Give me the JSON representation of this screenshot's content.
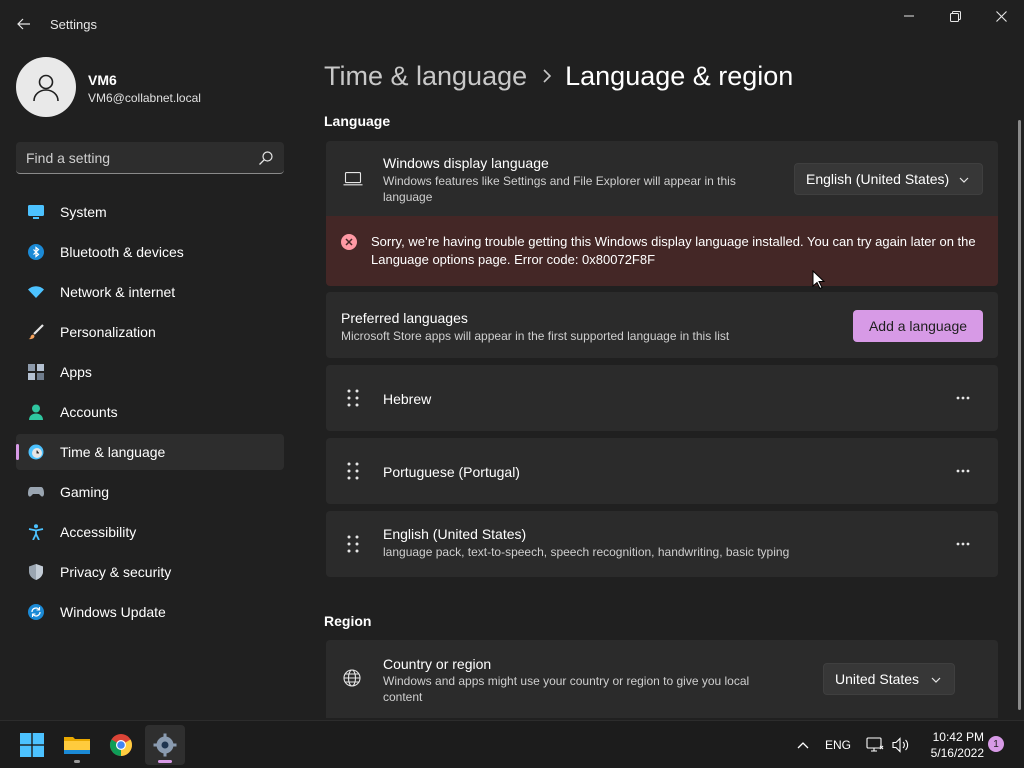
{
  "window": {
    "app_title": "Settings"
  },
  "profile": {
    "name": "VM6",
    "email": "VM6@collabnet.local"
  },
  "search": {
    "placeholder": "Find a setting"
  },
  "sidebar": {
    "items": [
      {
        "label": "System",
        "icon": "system-icon",
        "active": false
      },
      {
        "label": "Bluetooth & devices",
        "icon": "bluetooth-icon",
        "active": false
      },
      {
        "label": "Network & internet",
        "icon": "wifi-icon",
        "active": false
      },
      {
        "label": "Personalization",
        "icon": "brush-icon",
        "active": false
      },
      {
        "label": "Apps",
        "icon": "apps-icon",
        "active": false
      },
      {
        "label": "Accounts",
        "icon": "accounts-icon",
        "active": false
      },
      {
        "label": "Time & language",
        "icon": "time-language-icon",
        "active": true
      },
      {
        "label": "Gaming",
        "icon": "gamepad-icon",
        "active": false
      },
      {
        "label": "Accessibility",
        "icon": "accessibility-icon",
        "active": false
      },
      {
        "label": "Privacy & security",
        "icon": "shield-icon",
        "active": false
      },
      {
        "label": "Windows Update",
        "icon": "update-icon",
        "active": false
      }
    ]
  },
  "breadcrumb": {
    "parent": "Time & language",
    "current": "Language & region"
  },
  "language_section": {
    "title": "Language",
    "display_language": {
      "title": "Windows display language",
      "description": "Windows features like Settings and File Explorer will appear in this language",
      "selected": "English (United States)"
    },
    "error": {
      "message": "Sorry, we’re having trouble getting this Windows display language installed. You can try again later on the Language options page. Error code: 0x80072F8F"
    },
    "preferred": {
      "title": "Preferred languages",
      "description": "Microsoft Store apps will appear in the first supported language in this list",
      "add_button": "Add a language"
    },
    "languages": [
      {
        "name": "Hebrew",
        "description": ""
      },
      {
        "name": "Portuguese (Portugal)",
        "description": ""
      },
      {
        "name": "English (United States)",
        "description": "language pack, text-to-speech, speech recognition, handwriting, basic typing"
      }
    ]
  },
  "region_section": {
    "title": "Region",
    "country": {
      "title": "Country or region",
      "description": "Windows and apps might use your country or region to give you local content",
      "selected": "United States"
    }
  },
  "taskbar": {
    "apps": [
      {
        "name": "start-button"
      },
      {
        "name": "file-explorer"
      },
      {
        "name": "chrome"
      },
      {
        "name": "settings"
      }
    ],
    "tray_language": "ENG",
    "time": "10:42 PM",
    "date": "5/16/2022",
    "notification_count": "1"
  },
  "colors": {
    "accent": "#d79ae6",
    "background": "#202020",
    "card": "#2b2b2b",
    "error_bar": "#442726",
    "error_icon": "#ff99a4"
  }
}
